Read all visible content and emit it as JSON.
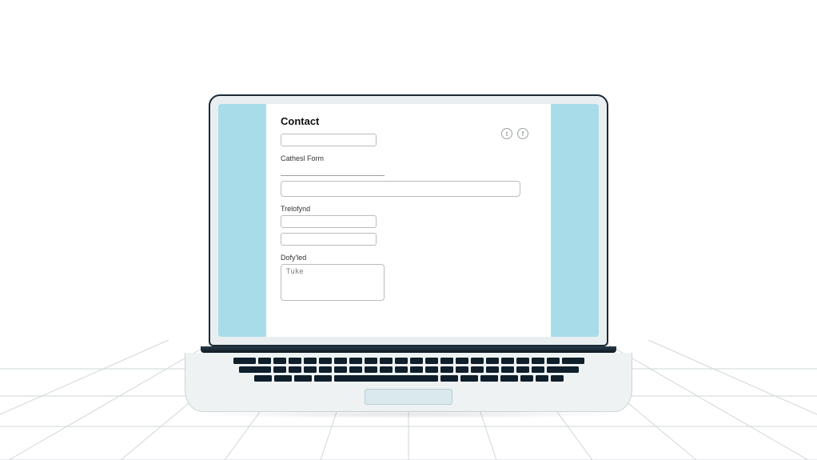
{
  "form": {
    "title": "Contact",
    "labels": {
      "section2": "Cathesl Form",
      "section3": "Trelofynd",
      "section4": "Dofy'led"
    },
    "fields": {
      "textarea_value": "Tuke"
    },
    "icons": {
      "left": "t",
      "right": "f"
    }
  }
}
